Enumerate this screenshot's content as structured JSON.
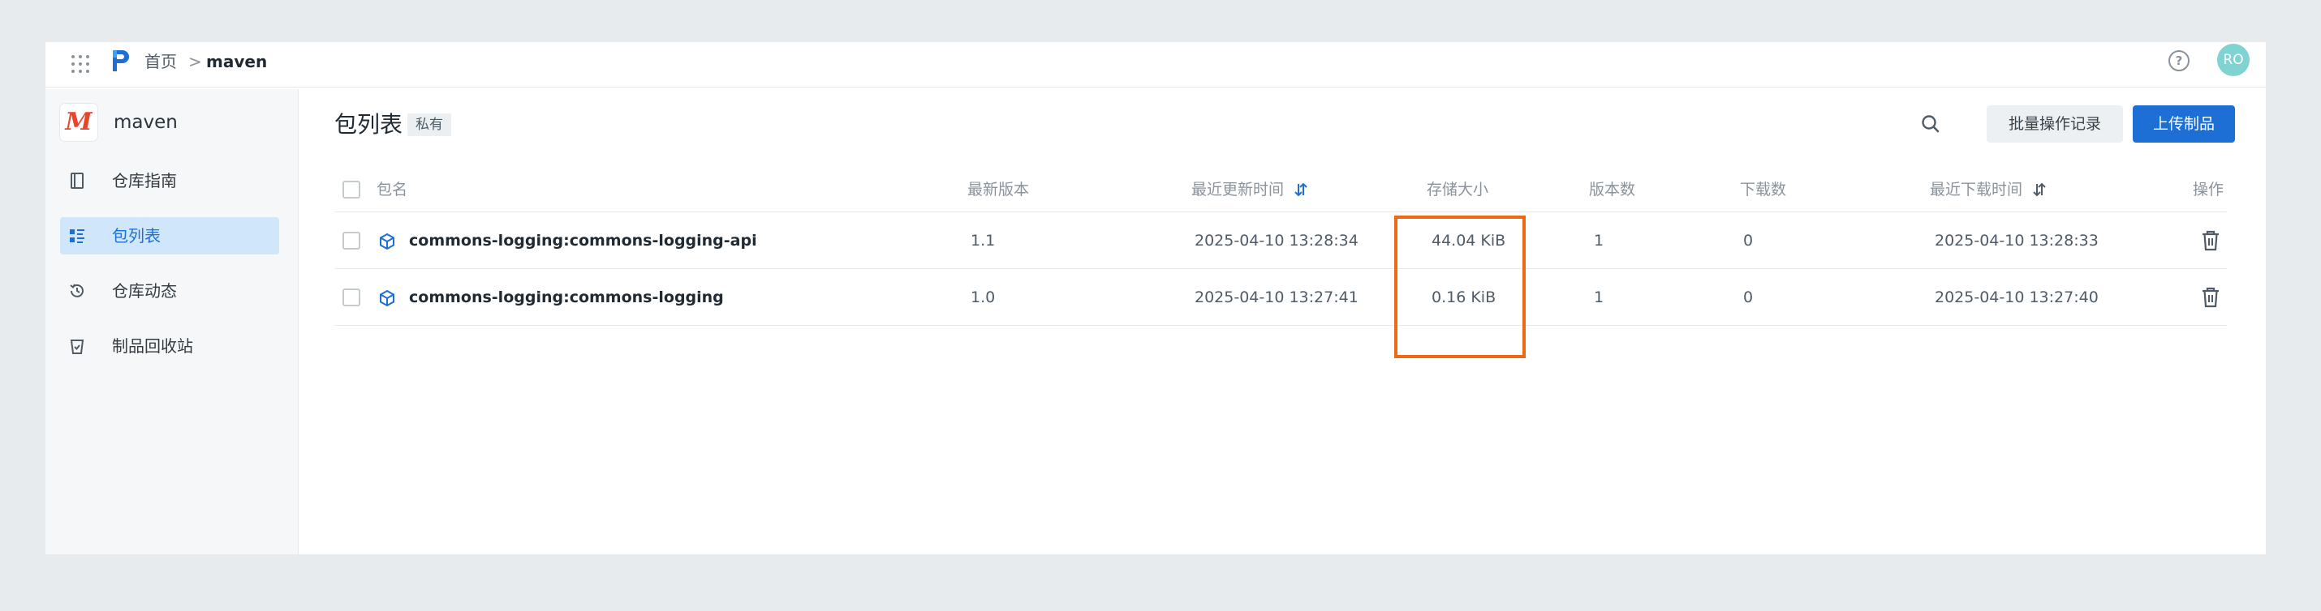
{
  "breadcrumb": {
    "home": "首页",
    "separator": ">",
    "current": "maven"
  },
  "header": {
    "avatar": "RO",
    "help": "?"
  },
  "sidebar": {
    "repo_logo": "M",
    "repo_name": "maven",
    "items": [
      {
        "label": "仓库指南",
        "icon": "book-icon",
        "active": false
      },
      {
        "label": "包列表",
        "icon": "list-icon",
        "active": true
      },
      {
        "label": "仓库动态",
        "icon": "history-icon",
        "active": false
      },
      {
        "label": "制品回收站",
        "icon": "recycle-bin-icon",
        "active": false
      }
    ]
  },
  "main": {
    "title": "包列表",
    "badge": "私有",
    "batch_button": "批量操作记录",
    "upload_button": "上传制品"
  },
  "table": {
    "columns": [
      "包名",
      "最新版本",
      "最近更新时间",
      "存储大小",
      "版本数",
      "下载数",
      "最近下载时间",
      "操作"
    ],
    "rows": [
      {
        "name": "commons-logging:commons-logging-api",
        "version": "1.1",
        "updated": "2025-04-10 13:28:34",
        "size": "44.04 KiB",
        "versions": "1",
        "downloads": "0",
        "last_download": "2025-04-10 13:28:33"
      },
      {
        "name": "commons-logging:commons-logging",
        "version": "1.0",
        "updated": "2025-04-10 13:27:41",
        "size": "0.16 KiB",
        "versions": "1",
        "downloads": "0",
        "last_download": "2025-04-10 13:27:40"
      }
    ]
  },
  "colors": {
    "accent": "#1d6fd6",
    "highlight": "#ed6a14",
    "active_bg": "#cfe6fb",
    "avatar": "#7fd3d3",
    "logo": "#e8452c"
  }
}
